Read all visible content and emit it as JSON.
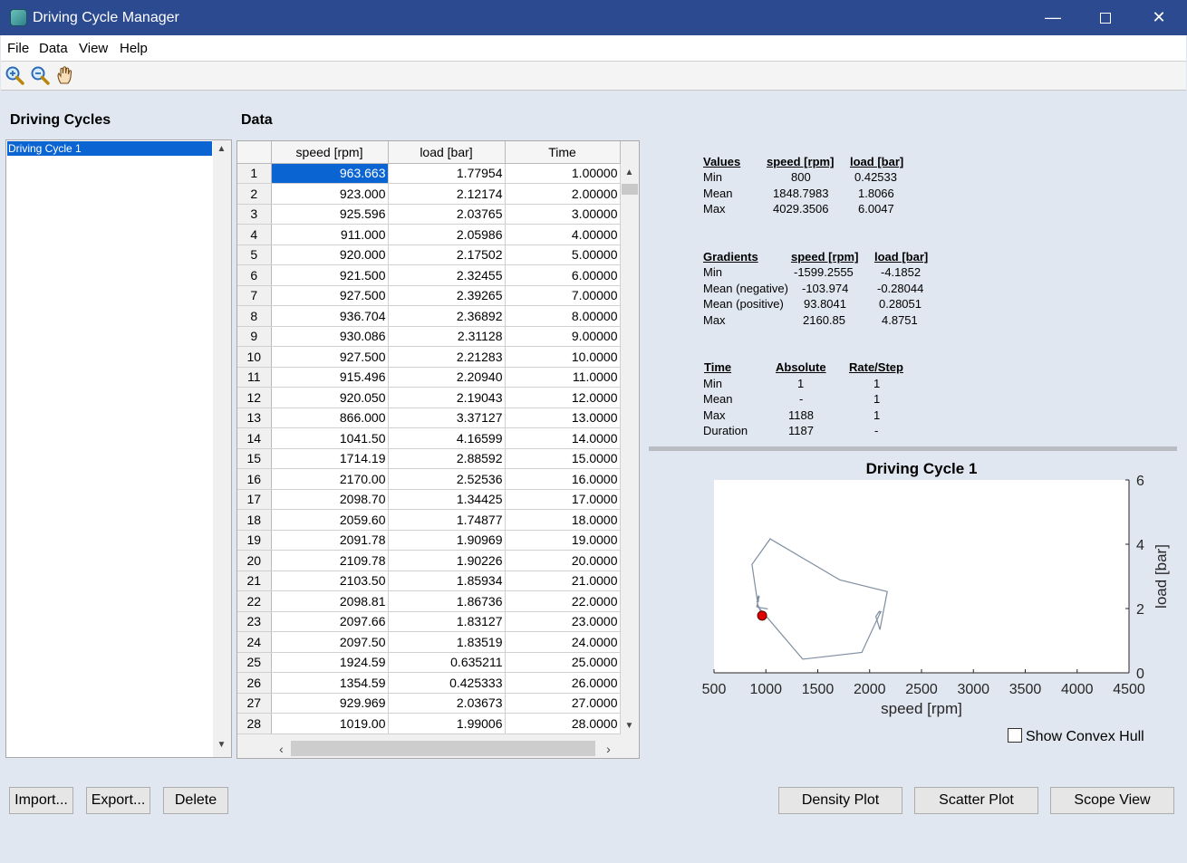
{
  "window": {
    "title": "Driving Cycle Manager",
    "minimize": "—",
    "close": "✕"
  },
  "menu": [
    "File",
    "Data",
    "View",
    "Help"
  ],
  "toolbar": {
    "tools": [
      "zoom-in-icon",
      "zoom-out-icon",
      "pan-hand-icon"
    ]
  },
  "cycles_panel": {
    "heading": "Driving Cycles",
    "items": [
      "Driving Cycle 1"
    ],
    "selected": "Driving Cycle 1"
  },
  "data_panel": {
    "heading": "Data",
    "columns": [
      "speed [rpm]",
      "load [bar]",
      "Time"
    ],
    "rows": [
      [
        "1",
        "963.663",
        "1.77954",
        "1.00000"
      ],
      [
        "2",
        "923.000",
        "2.12174",
        "2.00000"
      ],
      [
        "3",
        "925.596",
        "2.03765",
        "3.00000"
      ],
      [
        "4",
        "911.000",
        "2.05986",
        "4.00000"
      ],
      [
        "5",
        "920.000",
        "2.17502",
        "5.00000"
      ],
      [
        "6",
        "921.500",
        "2.32455",
        "6.00000"
      ],
      [
        "7",
        "927.500",
        "2.39265",
        "7.00000"
      ],
      [
        "8",
        "936.704",
        "2.36892",
        "8.00000"
      ],
      [
        "9",
        "930.086",
        "2.31128",
        "9.00000"
      ],
      [
        "10",
        "927.500",
        "2.21283",
        "10.0000"
      ],
      [
        "11",
        "915.496",
        "2.20940",
        "11.0000"
      ],
      [
        "12",
        "920.050",
        "2.19043",
        "12.0000"
      ],
      [
        "13",
        "866.000",
        "3.37127",
        "13.0000"
      ],
      [
        "14",
        "1041.50",
        "4.16599",
        "14.0000"
      ],
      [
        "15",
        "1714.19",
        "2.88592",
        "15.0000"
      ],
      [
        "16",
        "2170.00",
        "2.52536",
        "16.0000"
      ],
      [
        "17",
        "2098.70",
        "1.34425",
        "17.0000"
      ],
      [
        "18",
        "2059.60",
        "1.74877",
        "18.0000"
      ],
      [
        "19",
        "2091.78",
        "1.90969",
        "19.0000"
      ],
      [
        "20",
        "2109.78",
        "1.90226",
        "20.0000"
      ],
      [
        "21",
        "2103.50",
        "1.85934",
        "21.0000"
      ],
      [
        "22",
        "2098.81",
        "1.86736",
        "22.0000"
      ],
      [
        "23",
        "2097.66",
        "1.83127",
        "23.0000"
      ],
      [
        "24",
        "2097.50",
        "1.83519",
        "24.0000"
      ],
      [
        "25",
        "1924.59",
        "0.635211",
        "25.0000"
      ],
      [
        "26",
        "1354.59",
        "0.425333",
        "26.0000"
      ],
      [
        "27",
        "929.969",
        "2.03673",
        "27.0000"
      ],
      [
        "28",
        "1019.00",
        "1.99006",
        "28.0000"
      ]
    ]
  },
  "stats": {
    "values": {
      "headers": [
        "Values",
        "speed [rpm]",
        "load [bar]"
      ],
      "rows": [
        [
          "Min",
          "800",
          "0.42533"
        ],
        [
          "Mean",
          "1848.7983",
          "1.8066"
        ],
        [
          "Max",
          "4029.3506",
          "6.0047"
        ]
      ]
    },
    "gradients": {
      "headers": [
        "Gradients",
        "speed [rpm]",
        "load [bar]"
      ],
      "rows": [
        [
          "Min",
          "-1599.2555",
          "-4.1852"
        ],
        [
          "Mean (negative)",
          "-103.974",
          "-0.28044"
        ],
        [
          "Mean (positive)",
          "93.8041",
          "0.28051"
        ],
        [
          "Max",
          "2160.85",
          "4.8751"
        ]
      ]
    },
    "time": {
      "headers": [
        "Time",
        "Absolute",
        "Rate/Step"
      ],
      "rows": [
        [
          "Min",
          "1",
          "1"
        ],
        [
          "Mean",
          "-",
          "1"
        ],
        [
          "Max",
          "1188",
          "1"
        ],
        [
          "Duration",
          "1187",
          "-"
        ]
      ]
    }
  },
  "chart_data": {
    "type": "line",
    "title": "Driving Cycle 1",
    "xlabel": "speed [rpm]",
    "ylabel": "load [bar]",
    "xlim": [
      500,
      4500
    ],
    "ylim": [
      0,
      6
    ],
    "xticks": [
      "500",
      "1000",
      "1500",
      "2000",
      "2500",
      "3000",
      "3500",
      "4000",
      "4500"
    ],
    "yticks": [
      "0",
      "2",
      "4",
      "6"
    ],
    "y_axis_side": "right",
    "series": [
      {
        "x": [
          963.663,
          923.0,
          925.596,
          911.0,
          920.0,
          921.5,
          927.5,
          936.704,
          930.086,
          927.5,
          915.496,
          920.05,
          866.0,
          1041.5,
          1714.19,
          2170.0,
          2098.7,
          2059.6,
          2091.78,
          2109.78,
          2103.5,
          2098.81,
          2097.66,
          2097.5,
          1924.59,
          1354.59,
          929.969,
          1019.0
        ],
        "y": [
          1.77954,
          2.12174,
          2.03765,
          2.05986,
          2.17502,
          2.32455,
          2.39265,
          2.36892,
          2.31128,
          2.21283,
          2.2094,
          2.19043,
          3.37127,
          4.16599,
          2.88592,
          2.52536,
          1.34425,
          1.74877,
          1.90969,
          1.90226,
          1.85934,
          1.86736,
          1.83127,
          1.83519,
          0.635211,
          0.425333,
          2.03673,
          1.99006
        ],
        "color": "#7f8ea1"
      }
    ],
    "marker": {
      "x": 963.663,
      "y": 1.77954,
      "color": "#e00000"
    }
  },
  "options": {
    "show_convex_hull_label": "Show Convex Hull",
    "show_convex_hull": false
  },
  "buttons": {
    "import": "Import...",
    "export": "Export...",
    "delete": "Delete",
    "density_plot": "Density Plot",
    "scatter_plot": "Scatter Plot",
    "scope_view": "Scope View"
  }
}
